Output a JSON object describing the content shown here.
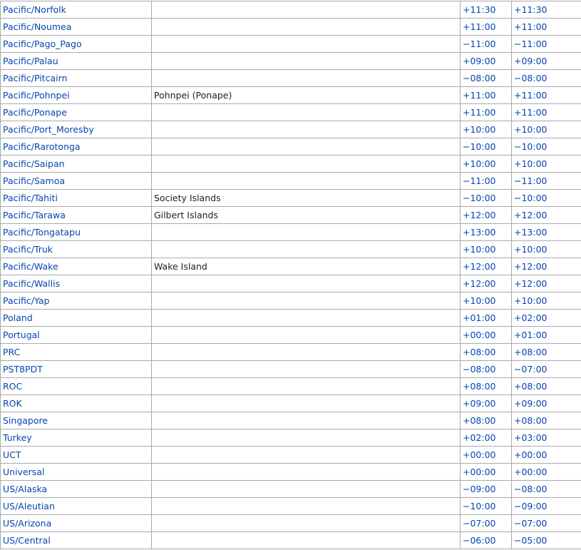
{
  "rows": [
    {
      "name": "Pacific/Norfolk",
      "comment": "",
      "utc_offset": "+11:30",
      "dst_offset": "+11:30"
    },
    {
      "name": "Pacific/Noumea",
      "comment": "",
      "utc_offset": "+11:00",
      "dst_offset": "+11:00"
    },
    {
      "name": "Pacific/Pago_Pago",
      "comment": "",
      "utc_offset": "−11:00",
      "dst_offset": "−11:00"
    },
    {
      "name": "Pacific/Palau",
      "comment": "",
      "utc_offset": "+09:00",
      "dst_offset": "+09:00"
    },
    {
      "name": "Pacific/Pitcairn",
      "comment": "",
      "utc_offset": "−08:00",
      "dst_offset": "−08:00"
    },
    {
      "name": "Pacific/Pohnpei",
      "comment": "Pohnpei (Ponape)",
      "utc_offset": "+11:00",
      "dst_offset": "+11:00"
    },
    {
      "name": "Pacific/Ponape",
      "comment": "",
      "utc_offset": "+11:00",
      "dst_offset": "+11:00"
    },
    {
      "name": "Pacific/Port_Moresby",
      "comment": "",
      "utc_offset": "+10:00",
      "dst_offset": "+10:00"
    },
    {
      "name": "Pacific/Rarotonga",
      "comment": "",
      "utc_offset": "−10:00",
      "dst_offset": "−10:00"
    },
    {
      "name": "Pacific/Saipan",
      "comment": "",
      "utc_offset": "+10:00",
      "dst_offset": "+10:00"
    },
    {
      "name": "Pacific/Samoa",
      "comment": "",
      "utc_offset": "−11:00",
      "dst_offset": "−11:00"
    },
    {
      "name": "Pacific/Tahiti",
      "comment": "Society Islands",
      "utc_offset": "−10:00",
      "dst_offset": "−10:00"
    },
    {
      "name": "Pacific/Tarawa",
      "comment": "Gilbert Islands",
      "utc_offset": "+12:00",
      "dst_offset": "+12:00"
    },
    {
      "name": "Pacific/Tongatapu",
      "comment": "",
      "utc_offset": "+13:00",
      "dst_offset": "+13:00"
    },
    {
      "name": "Pacific/Truk",
      "comment": "",
      "utc_offset": "+10:00",
      "dst_offset": "+10:00"
    },
    {
      "name": "Pacific/Wake",
      "comment": "Wake Island",
      "utc_offset": "+12:00",
      "dst_offset": "+12:00"
    },
    {
      "name": "Pacific/Wallis",
      "comment": "",
      "utc_offset": "+12:00",
      "dst_offset": "+12:00"
    },
    {
      "name": "Pacific/Yap",
      "comment": "",
      "utc_offset": "+10:00",
      "dst_offset": "+10:00"
    },
    {
      "name": "Poland",
      "comment": "",
      "utc_offset": "+01:00",
      "dst_offset": "+02:00"
    },
    {
      "name": "Portugal",
      "comment": "",
      "utc_offset": "+00:00",
      "dst_offset": "+01:00"
    },
    {
      "name": "PRC",
      "comment": "",
      "utc_offset": "+08:00",
      "dst_offset": "+08:00"
    },
    {
      "name": "PST8PDT",
      "comment": "",
      "utc_offset": "−08:00",
      "dst_offset": "−07:00"
    },
    {
      "name": "ROC",
      "comment": "",
      "utc_offset": "+08:00",
      "dst_offset": "+08:00"
    },
    {
      "name": "ROK",
      "comment": "",
      "utc_offset": "+09:00",
      "dst_offset": "+09:00"
    },
    {
      "name": "Singapore",
      "comment": "",
      "utc_offset": "+08:00",
      "dst_offset": "+08:00"
    },
    {
      "name": "Turkey",
      "comment": "",
      "utc_offset": "+02:00",
      "dst_offset": "+03:00"
    },
    {
      "name": "UCT",
      "comment": "",
      "utc_offset": "+00:00",
      "dst_offset": "+00:00"
    },
    {
      "name": "Universal",
      "comment": "",
      "utc_offset": "+00:00",
      "dst_offset": "+00:00"
    },
    {
      "name": "US/Alaska",
      "comment": "",
      "utc_offset": "−09:00",
      "dst_offset": "−08:00"
    },
    {
      "name": "US/Aleutian",
      "comment": "",
      "utc_offset": "−10:00",
      "dst_offset": "−09:00"
    },
    {
      "name": "US/Arizona",
      "comment": "",
      "utc_offset": "−07:00",
      "dst_offset": "−07:00"
    },
    {
      "name": "US/Central",
      "comment": "",
      "utc_offset": "−06:00",
      "dst_offset": "−05:00"
    }
  ]
}
